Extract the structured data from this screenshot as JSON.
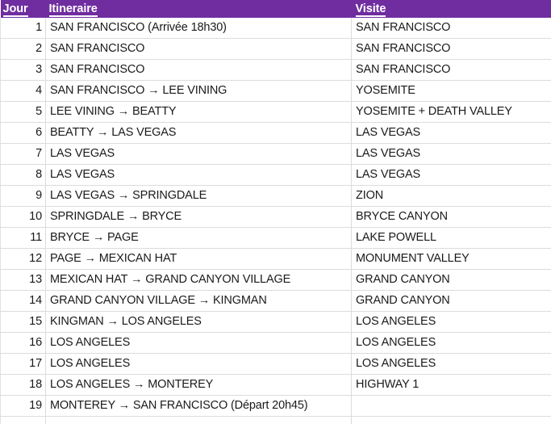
{
  "table": {
    "columns": [
      {
        "key": "jour",
        "label": "Jour"
      },
      {
        "key": "itineraire",
        "label": "Itineraire"
      },
      {
        "key": "visite",
        "label": "Visite"
      }
    ],
    "header_background": "#6F2DA0",
    "header_text_color": "#FFFFFF",
    "gridline_color": "#DCDCDC",
    "arrow_glyph": "→",
    "rows": [
      {
        "jour": "1",
        "itineraire": "SAN FRANCISCO (Arrivée 18h30)",
        "visite": "SAN FRANCISCO"
      },
      {
        "jour": "2",
        "itineraire": "SAN FRANCISCO",
        "visite": "SAN FRANCISCO"
      },
      {
        "jour": "3",
        "itineraire": "SAN FRANCISCO",
        "visite": "SAN FRANCISCO"
      },
      {
        "jour": "4",
        "itineraire": "SAN FRANCISCO → LEE VINING",
        "visite": "YOSEMITE"
      },
      {
        "jour": "5",
        "itineraire": "LEE VINING → BEATTY",
        "visite": "YOSEMITE + DEATH VALLEY"
      },
      {
        "jour": "6",
        "itineraire": "BEATTY → LAS VEGAS",
        "visite": "LAS VEGAS"
      },
      {
        "jour": "7",
        "itineraire": "LAS VEGAS",
        "visite": "LAS VEGAS"
      },
      {
        "jour": "8",
        "itineraire": "LAS VEGAS",
        "visite": "LAS VEGAS"
      },
      {
        "jour": "9",
        "itineraire": "LAS VEGAS → SPRINGDALE",
        "visite": "ZION"
      },
      {
        "jour": "10",
        "itineraire": "SPRINGDALE → BRYCE",
        "visite": "BRYCE CANYON"
      },
      {
        "jour": "11",
        "itineraire": "BRYCE → PAGE",
        "visite": "LAKE POWELL"
      },
      {
        "jour": "12",
        "itineraire": "PAGE → MEXICAN HAT",
        "visite": "MONUMENT VALLEY"
      },
      {
        "jour": "13",
        "itineraire": "MEXICAN HAT → GRAND CANYON VILLAGE",
        "visite": "GRAND CANYON"
      },
      {
        "jour": "14",
        "itineraire": "GRAND CANYON VILLAGE → KINGMAN",
        "visite": "GRAND CANYON"
      },
      {
        "jour": "15",
        "itineraire": "KINGMAN → LOS ANGELES",
        "visite": "LOS ANGELES"
      },
      {
        "jour": "16",
        "itineraire": "LOS ANGELES",
        "visite": "LOS ANGELES"
      },
      {
        "jour": "17",
        "itineraire": "LOS ANGELES",
        "visite": "LOS ANGELES"
      },
      {
        "jour": "18",
        "itineraire": "LOS ANGELES → MONTEREY",
        "visite": "HIGHWAY 1"
      },
      {
        "jour": "19",
        "itineraire": "MONTEREY → SAN FRANCISCO (Départ 20h45)",
        "visite": ""
      }
    ]
  }
}
